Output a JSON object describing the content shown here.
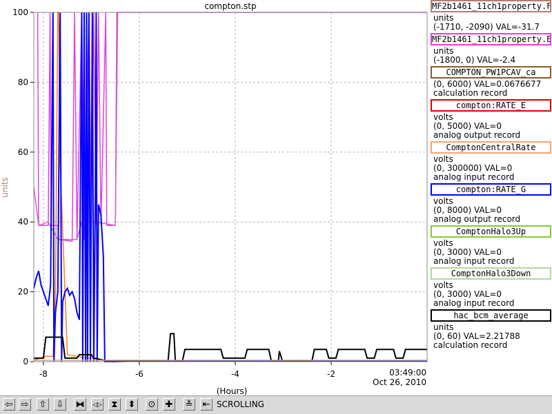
{
  "chart_data": {
    "type": "line",
    "title": "compton.stp",
    "xlabel": "(Hours)",
    "ylabel": "units",
    "xlim": [
      -8.2,
      0
    ],
    "ylim": [
      0,
      100
    ],
    "x_ticks": [
      -8,
      -6,
      -4,
      -2
    ],
    "x_tick_labels": [
      "-8",
      "-6",
      "-4",
      "-2"
    ],
    "y_ticks": [
      0,
      20,
      40,
      60,
      80,
      100
    ],
    "y_tick_labels": [
      "0",
      "20",
      "40",
      "60",
      "80",
      "100"
    ],
    "time_label": "03:49:00",
    "date_label": "Oct 26, 2010",
    "grid": true,
    "series": [
      {
        "color": "#ff7a1a",
        "points": [
          [
            -8.2,
            0.5
          ],
          [
            -8.05,
            1
          ],
          [
            -7.95,
            1.5
          ],
          [
            -7.8,
            1.5
          ],
          [
            -7.75,
            18
          ],
          [
            -7.7,
            100
          ],
          [
            -7.68,
            100
          ],
          [
            -7.66,
            60
          ],
          [
            -7.5,
            2
          ],
          [
            -7.3,
            1.5
          ],
          [
            -7.1,
            1
          ],
          [
            -6.9,
            1
          ],
          [
            -6.8,
            0.5
          ],
          [
            -6.7,
            0.3
          ],
          [
            -6,
            0.3
          ],
          [
            -4,
            0.3
          ],
          [
            -2,
            0.3
          ],
          [
            0,
            0.3
          ]
        ]
      },
      {
        "color": "#e040e0",
        "points": [
          [
            -8.12,
            100
          ],
          [
            -8.1,
            39
          ],
          [
            -7.9,
            39
          ],
          [
            -7.86,
            100
          ],
          [
            -7.84,
            39
          ],
          [
            -7.7,
            39
          ],
          [
            -7.68,
            35
          ],
          [
            -7.4,
            34.5
          ],
          [
            -7.35,
            100
          ],
          [
            -7.3,
            35
          ],
          [
            -7.2,
            100
          ],
          [
            -7.15,
            35
          ],
          [
            -7.05,
            100
          ],
          [
            -7.0,
            39
          ],
          [
            -6.95,
            100
          ],
          [
            -6.9,
            39
          ],
          [
            -6.85,
            100
          ],
          [
            -6.8,
            39
          ],
          [
            -6.7,
            100
          ],
          [
            -6.68,
            39
          ],
          [
            -6.5,
            39
          ],
          [
            -6.47,
            100
          ],
          [
            -6.2,
            100
          ],
          [
            -4,
            100
          ],
          [
            -2,
            100
          ],
          [
            0,
            100
          ]
        ]
      },
      {
        "color": "#cc66cc",
        "points": [
          [
            -8.2,
            50
          ],
          [
            -8.1,
            39
          ],
          [
            -7.9,
            40
          ],
          [
            -7.7,
            35
          ],
          [
            -7.3,
            35
          ],
          [
            -7.2,
            40
          ],
          [
            -6.9,
            40
          ],
          [
            -6.5,
            39
          ],
          [
            -6.45,
            100
          ]
        ]
      },
      {
        "color": "#0000ff",
        "points": [
          [
            -8.2,
            21
          ],
          [
            -8.15,
            24
          ],
          [
            -8.1,
            26
          ],
          [
            -8.05,
            22
          ],
          [
            -8.0,
            20
          ],
          [
            -7.95,
            18
          ],
          [
            -7.9,
            16
          ],
          [
            -7.85,
            22
          ],
          [
            -7.8,
            100
          ],
          [
            -7.78,
            0
          ],
          [
            -7.75,
            14
          ],
          [
            -7.7,
            20
          ],
          [
            -7.65,
            100
          ],
          [
            -7.62,
            0
          ],
          [
            -7.6,
            17
          ],
          [
            -7.55,
            20
          ],
          [
            -7.5,
            21
          ],
          [
            -7.45,
            19
          ],
          [
            -7.4,
            20
          ],
          [
            -7.35,
            18
          ],
          [
            -7.3,
            14
          ],
          [
            -7.25,
            12
          ],
          [
            -7.2,
            100
          ],
          [
            -7.18,
            0
          ],
          [
            -7.15,
            100
          ],
          [
            -7.12,
            0
          ],
          [
            -7.1,
            100
          ],
          [
            -7.08,
            0
          ],
          [
            -7.05,
            100
          ],
          [
            -7.02,
            0
          ],
          [
            -6.98,
            100
          ],
          [
            -6.95,
            0
          ],
          [
            -6.92,
            45
          ],
          [
            -6.9,
            100
          ],
          [
            -6.88,
            0
          ],
          [
            -6.85,
            45
          ],
          [
            -6.8,
            42
          ],
          [
            -6.75,
            30
          ],
          [
            -6.72,
            0
          ],
          [
            -6.7,
            0
          ],
          [
            -6.5,
            0
          ],
          [
            -6,
            0.2
          ],
          [
            -4,
            0.2
          ],
          [
            0,
            0.2
          ]
        ]
      },
      {
        "color": "#000000",
        "points": [
          [
            -8.2,
            1
          ],
          [
            -8.0,
            1
          ],
          [
            -7.95,
            7
          ],
          [
            -7.6,
            7
          ],
          [
            -7.55,
            1
          ],
          [
            -7.3,
            1
          ],
          [
            -7.25,
            2
          ],
          [
            -7.0,
            2
          ],
          [
            -6.95,
            1
          ],
          [
            -6.7,
            0.3
          ],
          [
            -6.0,
            0.3
          ],
          [
            -5.4,
            0.3
          ],
          [
            -5.35,
            8
          ],
          [
            -5.28,
            8
          ],
          [
            -5.25,
            0.3
          ],
          [
            -5.1,
            0.3
          ],
          [
            -5.05,
            3.5
          ],
          [
            -4.3,
            3.5
          ],
          [
            -4.25,
            1
          ],
          [
            -3.8,
            1
          ],
          [
            -3.75,
            3.5
          ],
          [
            -3.3,
            3.5
          ],
          [
            -3.25,
            0.3
          ],
          [
            -3.1,
            0.3
          ],
          [
            -3.08,
            3
          ],
          [
            -3.02,
            0.3
          ],
          [
            -2.4,
            0.3
          ],
          [
            -2.35,
            3.5
          ],
          [
            -2.1,
            3.5
          ],
          [
            -2.05,
            1
          ],
          [
            -1.9,
            1
          ],
          [
            -1.85,
            3.5
          ],
          [
            -1.3,
            3.5
          ],
          [
            -1.25,
            1
          ],
          [
            -1.1,
            1
          ],
          [
            -1.05,
            3.5
          ],
          [
            -0.7,
            3.5
          ],
          [
            -0.65,
            1
          ],
          [
            -0.5,
            1
          ],
          [
            -0.45,
            3.5
          ],
          [
            0,
            3.5
          ]
        ]
      },
      {
        "color": "#c8a090",
        "points": [
          [
            -8.2,
            0.4
          ],
          [
            -6,
            0.4
          ],
          [
            -4,
            0.4
          ],
          [
            -2,
            0.4
          ],
          [
            0,
            0.4
          ]
        ]
      }
    ]
  },
  "legend": [
    {
      "box_label": "MF2b1461_11ch1property.F",
      "color": "#b08070",
      "lines": [
        "units",
        "(-1710, -2090) VAL=-31.7"
      ]
    },
    {
      "box_label": "MF2b1461_11ch1property.E",
      "color": "#e040e0",
      "lines": [
        "units",
        "(-1800, 0) VAL=-2.4"
      ]
    },
    {
      "box_label": "COMPTON_PW1PCAV_ca",
      "color": "#8b5a2b",
      "lines": [
        "(0, 6000) VAL=0.0676677",
        "calculation record"
      ]
    },
    {
      "box_label": "compton:RATE_E",
      "color": "#dd0000",
      "lines": [
        "volts",
        "(0, 5000)  VAL=0",
        "analog output record"
      ]
    },
    {
      "box_label": "ComptonCentralRate",
      "color": "#ffa070",
      "lines": [
        "volts",
        "(0, 300000) VAL=0",
        "analog input record"
      ]
    },
    {
      "box_label": "compton:RATE_G",
      "color": "#0000ff",
      "lines": [
        "volts",
        "(0, 8000) VAL=0",
        "analog output record"
      ]
    },
    {
      "box_label": "ComptonHalo3Up",
      "color": "#80cc30",
      "lines": [
        "volts",
        "(0, 3000)  VAL=0",
        "analog input record"
      ]
    },
    {
      "box_label": "ComptonHalo3Down",
      "color": "#b0d8a0",
      "lines": [
        "volts",
        "(0, 3000)  VAL=0",
        "analog input record"
      ]
    },
    {
      "box_label": "hac_bcm_average",
      "color": "#000000",
      "lines": [
        "units",
        "(0, 60) VAL=2.21788",
        "calculation record"
      ]
    }
  ],
  "toolbar": {
    "buttons": [
      {
        "name": "scroll-left-button",
        "glyph": "⇦"
      },
      {
        "name": "scroll-right-button",
        "glyph": "⇨"
      },
      {
        "name": "scroll-up-button",
        "glyph": "⇧"
      },
      {
        "name": "scroll-down-button",
        "glyph": "⇩"
      },
      {
        "name": "zoom-in-x-button",
        "glyph": "⧓"
      },
      {
        "name": "zoom-out-x-button",
        "glyph": "◁▷"
      },
      {
        "name": "zoom-in-y-button",
        "glyph": "⧗"
      },
      {
        "name": "zoom-out-y-button",
        "glyph": "⬍"
      },
      {
        "name": "autoscale-button",
        "glyph": "⊙"
      },
      {
        "name": "add-button",
        "glyph": "✚"
      },
      {
        "name": "config-button",
        "glyph": "≚"
      },
      {
        "name": "export-button",
        "glyph": "⇤"
      }
    ],
    "status": "SCROLLING"
  }
}
